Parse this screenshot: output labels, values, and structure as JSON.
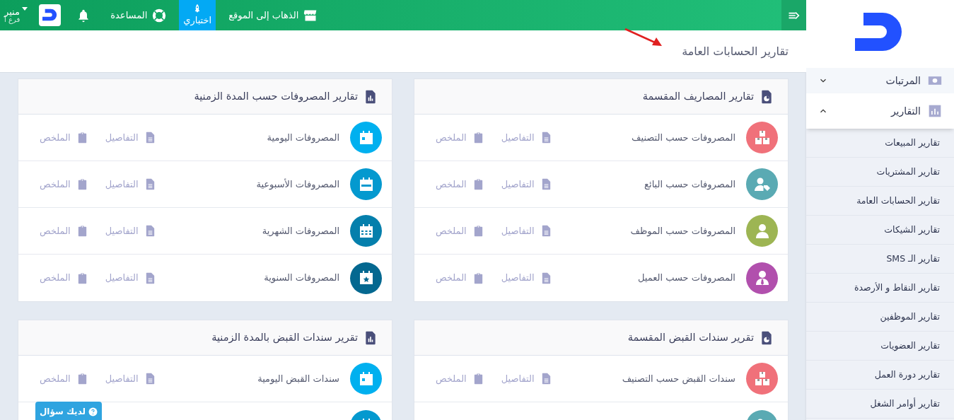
{
  "topbar": {
    "links": [
      {
        "label": "الذهاب إلى الموقع",
        "kind": "store",
        "selected": false
      },
      {
        "label": "اختباري",
        "kind": "rocket",
        "selected": true
      },
      {
        "label": "المساعدة",
        "kind": "lifebuoy",
        "selected": false
      }
    ],
    "user": {
      "name": "منير",
      "branch": "فرع أ"
    }
  },
  "page_title": "تقارير الحسابات العامة",
  "cards": [
    {
      "title": "تقارير المصاريف المقسمة",
      "kind": "pie",
      "rows": [
        {
          "label": "المصروفات حسب التصنيف",
          "kind": "boxes",
          "color": "#f0717a",
          "details": "التفاصيل",
          "summary": "الملخص"
        },
        {
          "label": "المصروفات حسب البائع",
          "kind": "user-tag",
          "color": "#5aaab3",
          "details": "التفاصيل",
          "summary": "الملخص"
        },
        {
          "label": "المصروفات حسب الموظف",
          "kind": "user",
          "color": "#9db553",
          "details": "التفاصيل",
          "summary": "الملخص"
        },
        {
          "label": "المصروفات حسب العميل",
          "kind": "user-tie",
          "color": "#b150ad",
          "details": "التفاصيل",
          "summary": "الملخص"
        }
      ]
    },
    {
      "title": "تقارير المصروفات حسب المدة الزمنية",
      "kind": "bar",
      "rows": [
        {
          "label": "المصروفات اليومية",
          "kind": "cal-day",
          "color": "#00b0ef",
          "details": "التفاصيل",
          "summary": "الملخص"
        },
        {
          "label": "المصروفات الأسبوعية",
          "kind": "cal-week",
          "color": "#0499cf",
          "details": "التفاصيل",
          "summary": "الملخص"
        },
        {
          "label": "المصروفات الشهرية",
          "kind": "cal-month",
          "color": "#047fac",
          "details": "التفاصيل",
          "summary": "الملخص"
        },
        {
          "label": "المصروفات السنوية",
          "kind": "cal-star",
          "color": "#046890",
          "details": "التفاصيل",
          "summary": "الملخص"
        }
      ]
    },
    {
      "title": "تقرير سندات القبض المقسمة",
      "kind": "pie",
      "rows": [
        {
          "label": "سندات القبض حسب التصنيف",
          "kind": "boxes",
          "color": "#f0717a",
          "details": "التفاصيل",
          "summary": "الملخص"
        },
        {
          "kind": "user-tag",
          "color": "#5aaab3"
        }
      ]
    },
    {
      "title": "تقرير سندات القبض بالمدة الزمنية",
      "kind": "bar",
      "rows": [
        {
          "label": "سندات القبض اليومية",
          "kind": "cal-day",
          "color": "#00b0ef",
          "details": "التفاصيل",
          "summary": "الملخص"
        },
        {
          "kind": "cal-week",
          "color": "#0499cf"
        }
      ]
    }
  ],
  "sidebar": {
    "items": [
      {
        "label": "المرتبات",
        "kind": "money",
        "expanded": false
      },
      {
        "label": "التقارير",
        "kind": "chart",
        "expanded": true,
        "children": [
          {
            "label": "تقارير المبيعات"
          },
          {
            "label": "تقارير المشتريات"
          },
          {
            "label": "تقارير الحسابات العامة"
          },
          {
            "label": "تقارير الشيكات"
          },
          {
            "label": "تقارير الـ SMS"
          },
          {
            "label": "تقارير النقاط و الأرصدة"
          },
          {
            "label": "تقارير الموظفين"
          },
          {
            "label": "تقارير العضويات"
          },
          {
            "label": "تقارير دورة العمل"
          },
          {
            "label": "تقارير أوامر الشغل"
          }
        ]
      }
    ]
  },
  "help_button": "لديك سؤال"
}
